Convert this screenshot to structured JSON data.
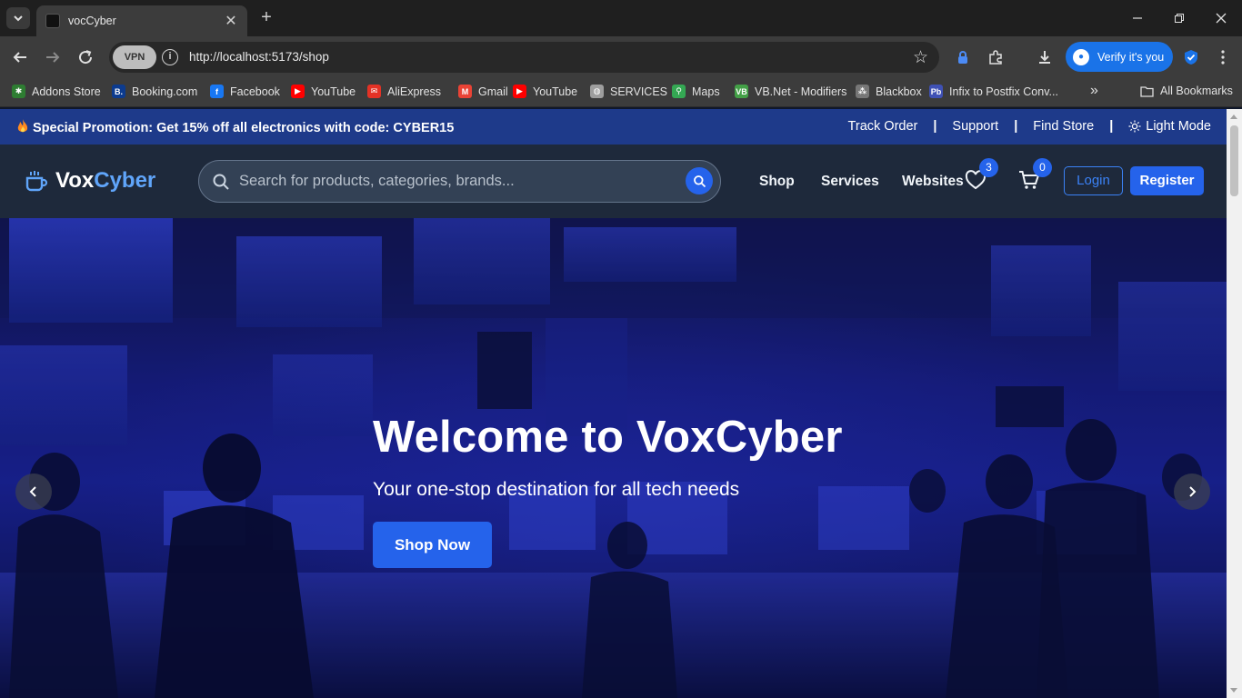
{
  "browser": {
    "tab_title": "vocCyber",
    "url": "http://localhost:5173/shop",
    "vpn_label": "VPN",
    "verify_label": "Verify it's you",
    "bookmarks": [
      {
        "label": "Addons Store",
        "icon": "addons-icon",
        "color": "#2e7d32"
      },
      {
        "label": "Booking.com",
        "icon": "booking-icon",
        "color": "#0c3b8f"
      },
      {
        "label": "Facebook",
        "icon": "facebook-icon",
        "color": "#1877f2"
      },
      {
        "label": "YouTube",
        "icon": "youtube-icon",
        "color": "#ff0000"
      },
      {
        "label": "AliExpress",
        "icon": "aliexpress-icon",
        "color": "#e43225"
      },
      {
        "label": "Gmail",
        "icon": "gmail-icon",
        "color": "#ea4335"
      },
      {
        "label": "YouTube",
        "icon": "youtube-icon",
        "color": "#ff0000"
      },
      {
        "label": "SERVICES",
        "icon": "globe-icon",
        "color": "#9e9e9e"
      },
      {
        "label": "Maps",
        "icon": "maps-icon",
        "color": "#34a853"
      },
      {
        "label": "VB.Net - Modifiers",
        "icon": "vbnet-icon",
        "color": "#43a047"
      },
      {
        "label": "Blackbox",
        "icon": "blackbox-icon",
        "color": "#777777"
      },
      {
        "label": "Infix to Postfix Conv...",
        "icon": "infix-icon",
        "color": "#3f51b5"
      }
    ],
    "all_bookmarks_label": "All Bookmarks"
  },
  "promo": {
    "text_prefix": "Special Promotion: Get 15% off all electronics with code: ",
    "code": "CYBER15",
    "links": [
      "Track Order",
      "Support",
      "Find Store",
      "Light Mode"
    ]
  },
  "header": {
    "logo_part1": "Vox",
    "logo_part2": "Cyber",
    "search_placeholder": "Search for products, categories, brands...",
    "nav": [
      "Shop",
      "Services",
      "Websites"
    ],
    "wishlist_count": "3",
    "cart_count": "0",
    "login_label": "Login",
    "register_label": "Register"
  },
  "hero": {
    "title": "Welcome to VoxCyber",
    "subtitle": "Your one-stop destination for all tech needs",
    "cta_label": "Shop Now"
  },
  "colors": {
    "accent": "#2563eb",
    "promo_bar": "#1e3a8a",
    "header_bg": "#1e293b",
    "logo_accent": "#60a5fa"
  }
}
